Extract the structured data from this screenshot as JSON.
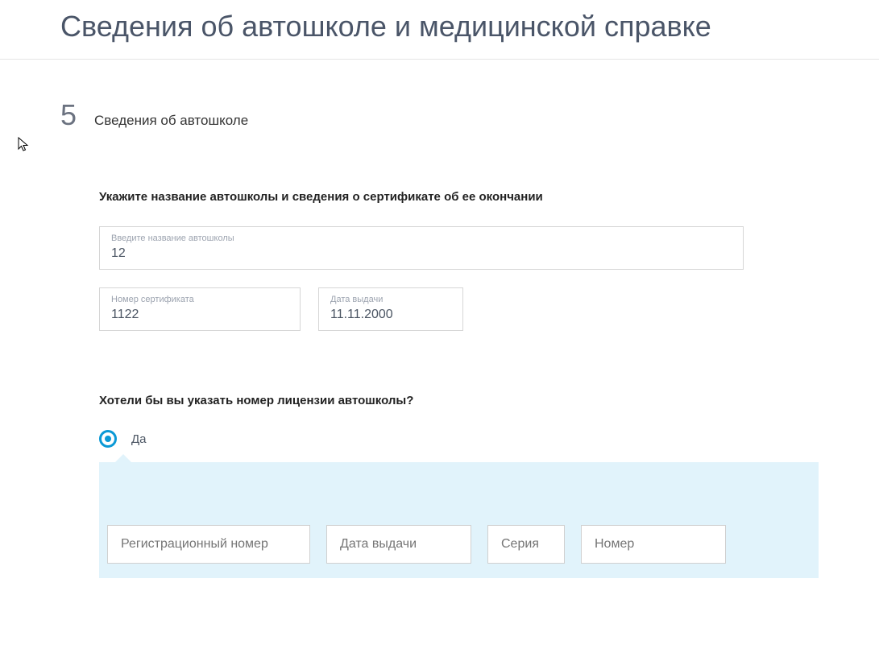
{
  "page": {
    "title": "Сведения об автошколе и медицинской справке"
  },
  "section": {
    "number": "5",
    "title": "Сведения об автошколе"
  },
  "subheading1": "Укажите название автошколы и сведения о сертификате об ее окончании",
  "school_name": {
    "label": "Введите название автошколы",
    "value": "12"
  },
  "cert_number": {
    "label": "Номер сертификата",
    "value": "1122"
  },
  "issue_date": {
    "label": "Дата выдачи",
    "value": "11.11.2000"
  },
  "question": "Хотели бы вы указать номер лицензии автошколы?",
  "radio_yes": "Да",
  "license": {
    "reg_number_ph": "Регистрационный номер",
    "issue_date_ph": "Дата выдачи",
    "series_ph": "Серия",
    "number_ph": "Номер"
  }
}
